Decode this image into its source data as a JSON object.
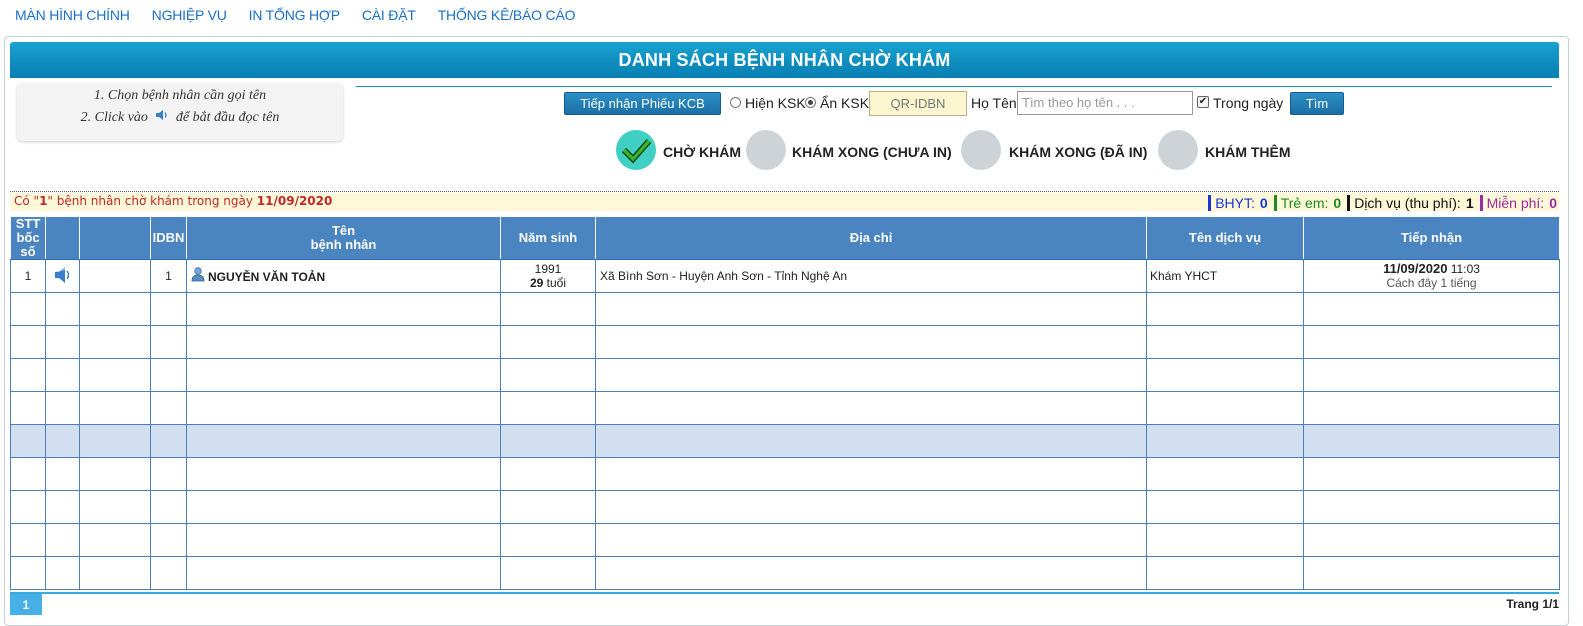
{
  "nav": [
    "MÀN HÌNH CHÍNH",
    "NGHIỆP VỤ",
    "IN TỔNG HỢP",
    "CÀI ĐẶT",
    "THỐNG KÊ/BÁO CÁO"
  ],
  "title": "DANH SÁCH BỆNH NHÂN CHỜ KHÁM",
  "help": {
    "line1": "1. Chọn bệnh nhân cần gọi tên",
    "line2_pre": "2. Click vào",
    "line2_post": "để bắt đầu đọc tên"
  },
  "toolbar": {
    "tiep_nhan_button": "Tiếp nhận Phiếu KCB",
    "hien_ksk": "Hiện KSK",
    "an_ksk": "Ẩn KSK",
    "an_ksk_selected": true,
    "qr_value": "QR-IDBN",
    "ho_ten_label": "Họ Tên",
    "search_placeholder": "Tìm theo họ tên . . .",
    "trong_ngay_label": "Trong ngày",
    "trong_ngay_checked": true,
    "tim_button": "Tìm"
  },
  "status_tabs": [
    {
      "label": "CHỜ KHÁM",
      "active": true
    },
    {
      "label": "KHÁM XONG (CHƯA IN)",
      "active": false
    },
    {
      "label": "KHÁM XONG (ĐÃ IN)",
      "active": false
    },
    {
      "label": "KHÁM THÊM",
      "active": false
    }
  ],
  "info": {
    "prefix": "Có \"",
    "count": "1",
    "middle": "\" bệnh nhân chờ khám trong ngày ",
    "date": "11/09/2020"
  },
  "counts": [
    {
      "label": "BHYT:",
      "value": "0",
      "color": "#1a35d6"
    },
    {
      "label": "Trẻ em:",
      "value": "0",
      "color": "#1f8a1f"
    },
    {
      "label": "Dịch vụ (thu phí):",
      "value": "1",
      "color": "#111111"
    },
    {
      "label": "Miễn phí:",
      "value": "0",
      "color": "#9c2aa0"
    }
  ],
  "columns": {
    "stt_line1": "STT",
    "stt_line2": "bốc số",
    "idbn": "IDBN",
    "ten_line1": "Tên",
    "ten_line2": "bệnh nhân",
    "nam_sinh": "Năm sinh",
    "dia_chi": "Địa chỉ",
    "ten_dich_vu": "Tên dịch vụ",
    "tiep_nhan": "Tiếp nhận"
  },
  "rows": [
    {
      "stt": "1",
      "idbn": "1",
      "name": "NGUYỄN VĂN TOẢN",
      "year": "1991",
      "age_num": "29",
      "age_unit": " tuổi",
      "address": "Xã Bình Sơn - Huyện Anh Sơn - Tỉnh Nghệ An",
      "service": "Khám YHCT",
      "date": "11/09/2020",
      "time": " 11:03",
      "ago": "Cách đây 1 tiếng"
    }
  ],
  "empty_rows": 9,
  "selected_empty_row": 4,
  "pager": {
    "current": "1",
    "info": "Trang 1/1"
  }
}
